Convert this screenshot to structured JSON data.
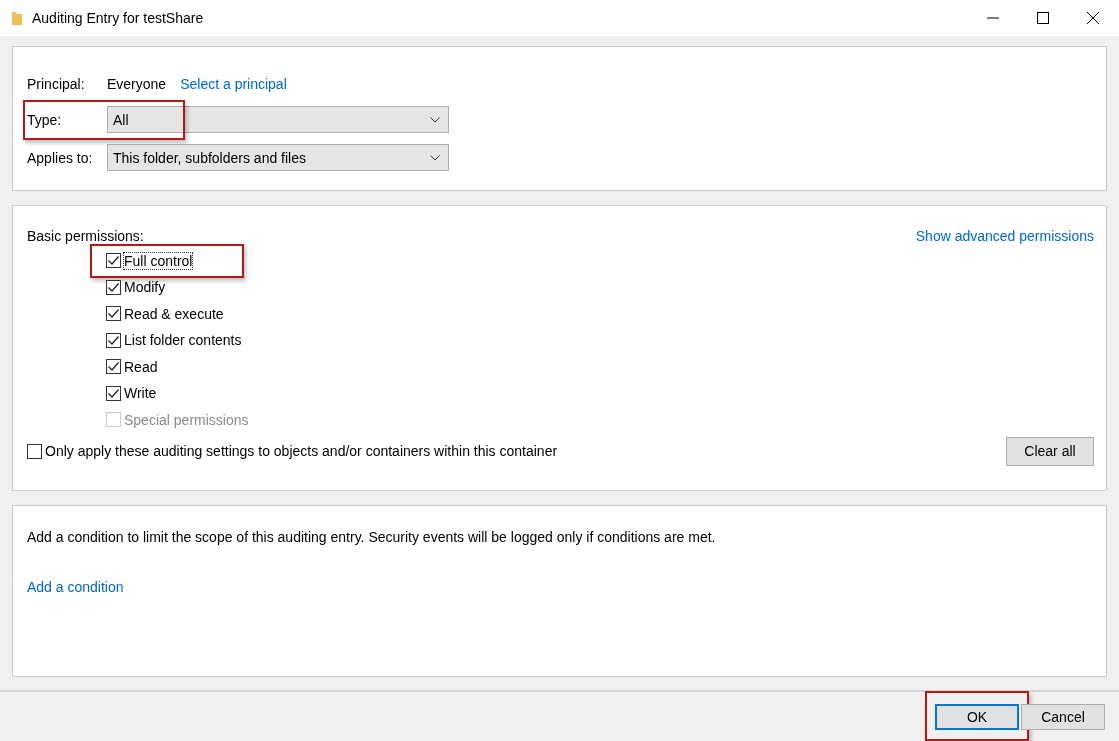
{
  "window": {
    "title": "Auditing Entry for testShare"
  },
  "principal": {
    "label": "Principal:",
    "value": "Everyone",
    "link": "Select a principal"
  },
  "fields": [
    {
      "label": "Type:",
      "value": "All",
      "highlighted": true
    },
    {
      "label": "Applies to:",
      "value": "This folder, subfolders and files"
    }
  ],
  "permissions": {
    "heading": "Basic permissions:",
    "advanced_link": "Show advanced permissions",
    "items": [
      {
        "label": "Full control",
        "checked": true,
        "disabled": false,
        "focused": true,
        "highlighted": true
      },
      {
        "label": "Modify",
        "checked": true,
        "disabled": false,
        "focused": false
      },
      {
        "label": "Read & execute",
        "checked": true,
        "disabled": false,
        "focused": false
      },
      {
        "label": "List folder contents",
        "checked": true,
        "disabled": false,
        "focused": false
      },
      {
        "label": "Read",
        "checked": true,
        "disabled": false,
        "focused": false
      },
      {
        "label": "Write",
        "checked": true,
        "disabled": false,
        "focused": false
      },
      {
        "label": "Special permissions",
        "checked": false,
        "disabled": true,
        "focused": false
      }
    ],
    "only_apply": {
      "label": "Only apply these auditing settings to objects and/or containers within this container",
      "checked": false
    },
    "clear_button": "Clear all"
  },
  "condition": {
    "text": "Add a condition to limit the scope of this auditing entry. Security events will be logged only if conditions are met.",
    "link": "Add a condition"
  },
  "buttons": [
    {
      "label": "OK",
      "default": true,
      "highlighted": true
    },
    {
      "label": "Cancel",
      "default": false
    }
  ]
}
